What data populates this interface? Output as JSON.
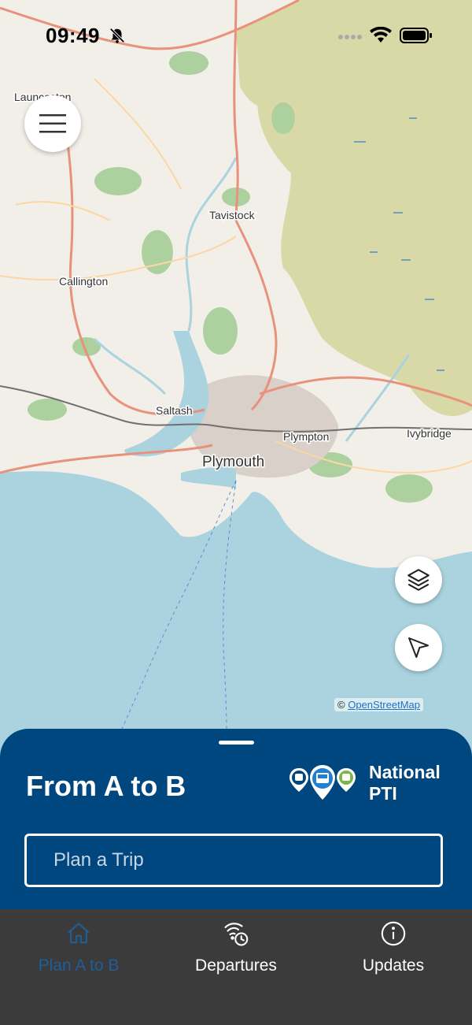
{
  "status_bar": {
    "time": "09:49"
  },
  "map": {
    "places": [
      {
        "name": "Launceston"
      },
      {
        "name": "Tavistock"
      },
      {
        "name": "Callington"
      },
      {
        "name": "Saltash"
      },
      {
        "name": "Plymouth"
      },
      {
        "name": "Plympton"
      },
      {
        "name": "Ivybridge"
      }
    ],
    "attribution_prefix": "©",
    "attribution_link": "OpenStreetMap"
  },
  "sheet": {
    "title": "From A to B",
    "brand_line1": "National",
    "brand_line2": "PTI",
    "search_placeholder": "Plan a Trip",
    "accent_color": "#00467f"
  },
  "tabs": [
    {
      "label": "Plan A to B",
      "icon": "home-icon",
      "active": true
    },
    {
      "label": "Departures",
      "icon": "departures-icon",
      "active": false
    },
    {
      "label": "Updates",
      "icon": "info-icon",
      "active": false
    }
  ]
}
